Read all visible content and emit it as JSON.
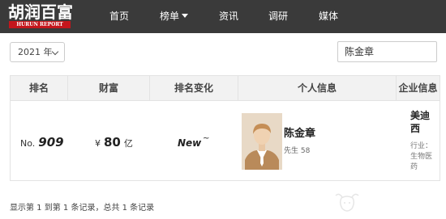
{
  "header": {
    "logo_cn": "胡润百富",
    "logo_en": "HURUN REPORT",
    "nav": [
      {
        "label": "首页"
      },
      {
        "label": "榜单"
      },
      {
        "label": "资讯"
      },
      {
        "label": "调研"
      },
      {
        "label": "媒体"
      }
    ]
  },
  "controls": {
    "year_value": "2021 年",
    "search_value": "陈金章"
  },
  "table": {
    "headers": [
      "排名",
      "财富",
      "排名变化",
      "个人信息",
      "企业信息"
    ],
    "rows": [
      {
        "rank_prefix": "No.",
        "rank": "909",
        "currency": "¥",
        "wealth": "80",
        "wealth_unit": "亿",
        "change": "New",
        "change_mark": "~",
        "name": "陈金章",
        "gender_age": "先生  58",
        "company": "美迪西",
        "industry": "行业：生物医药"
      }
    ]
  },
  "footer": {
    "summary": "显示第 1 到第 1 条记录，总共 1 条记录"
  },
  "colors": {
    "nav_bg": "#3a3a3a",
    "logo_red": "#c4161c",
    "header_bg": "#f2f2f2"
  }
}
